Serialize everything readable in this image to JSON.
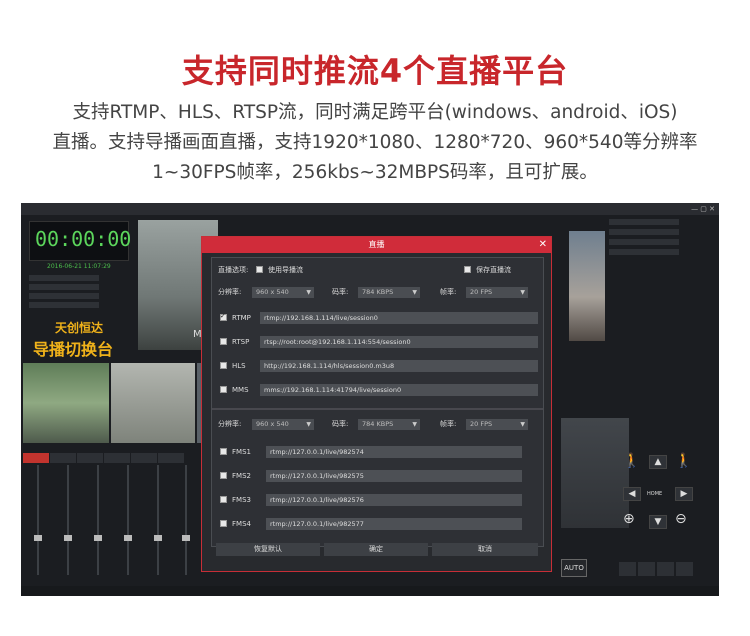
{
  "headline": "支持同时推流4个直播平台",
  "description": {
    "line1": "支持RTMP、HLS、RTSP流，同时满足跨平台(windows、android、iOS)",
    "line2": "直播。支持导播画面直播，支持1920*1080、1280*720、960*540等分辨率",
    "line3": "1~30FPS帧率，256kbs~32MBPS码率，且可扩展。"
  },
  "app": {
    "timer": "00:00:00",
    "date": "2016-06-21 11:07:29",
    "logo_line1": "天创恒达",
    "logo_line2": "导播切换台",
    "overlay_text": "MV",
    "auto_label": "AUTO",
    "home_label": "HOME"
  },
  "dialog": {
    "title": "直播",
    "close_icon": "close-icon",
    "live_options_label": "直播选项:",
    "use_director_label": "使用导播流",
    "save_stream_label": "保存直播流",
    "top": {
      "resolution_label": "分辨率:",
      "resolution_value": "960 x 540",
      "bitrate_label": "码率:",
      "bitrate_value": "784 KBPS",
      "framerate_label": "帧率:",
      "framerate_value": "20 FPS"
    },
    "streams": [
      {
        "name": "RTMP",
        "checked": true,
        "url": "rtmp://192.168.1.114/live/session0"
      },
      {
        "name": "RTSP",
        "checked": false,
        "url": "rtsp://root:root@192.168.1.114:554/session0"
      },
      {
        "name": "HLS",
        "checked": false,
        "url": "http://192.168.1.114/hls/session0.m3u8"
      },
      {
        "name": "MMS",
        "checked": false,
        "url": "mms://192.168.1.114:41794/live/session0"
      }
    ],
    "bottom": {
      "resolution_label": "分辨率:",
      "resolution_value": "960 x 540",
      "bitrate_label": "码率:",
      "bitrate_value": "784 KBPS",
      "framerate_label": "帧率:",
      "framerate_value": "20 FPS"
    },
    "fms": [
      {
        "name": "FMS1",
        "checked": false,
        "url": "rtmp://127.0.0.1/live/982574"
      },
      {
        "name": "FMS2",
        "checked": false,
        "url": "rtmp://127.0.0.1/live/982575"
      },
      {
        "name": "FMS3",
        "checked": false,
        "url": "rtmp://127.0.0.1/live/982576"
      },
      {
        "name": "FMS4",
        "checked": false,
        "url": "rtmp://127.0.0.1/live/982577"
      }
    ],
    "buttons": {
      "restore": "恢复默认",
      "ok": "确定",
      "cancel": "取消"
    }
  },
  "colors": {
    "accent_red": "#c8262b",
    "dialog_title_red": "#d02c3a",
    "timer_green": "#5cd65c",
    "logo_yellow": "#f0b21a"
  }
}
